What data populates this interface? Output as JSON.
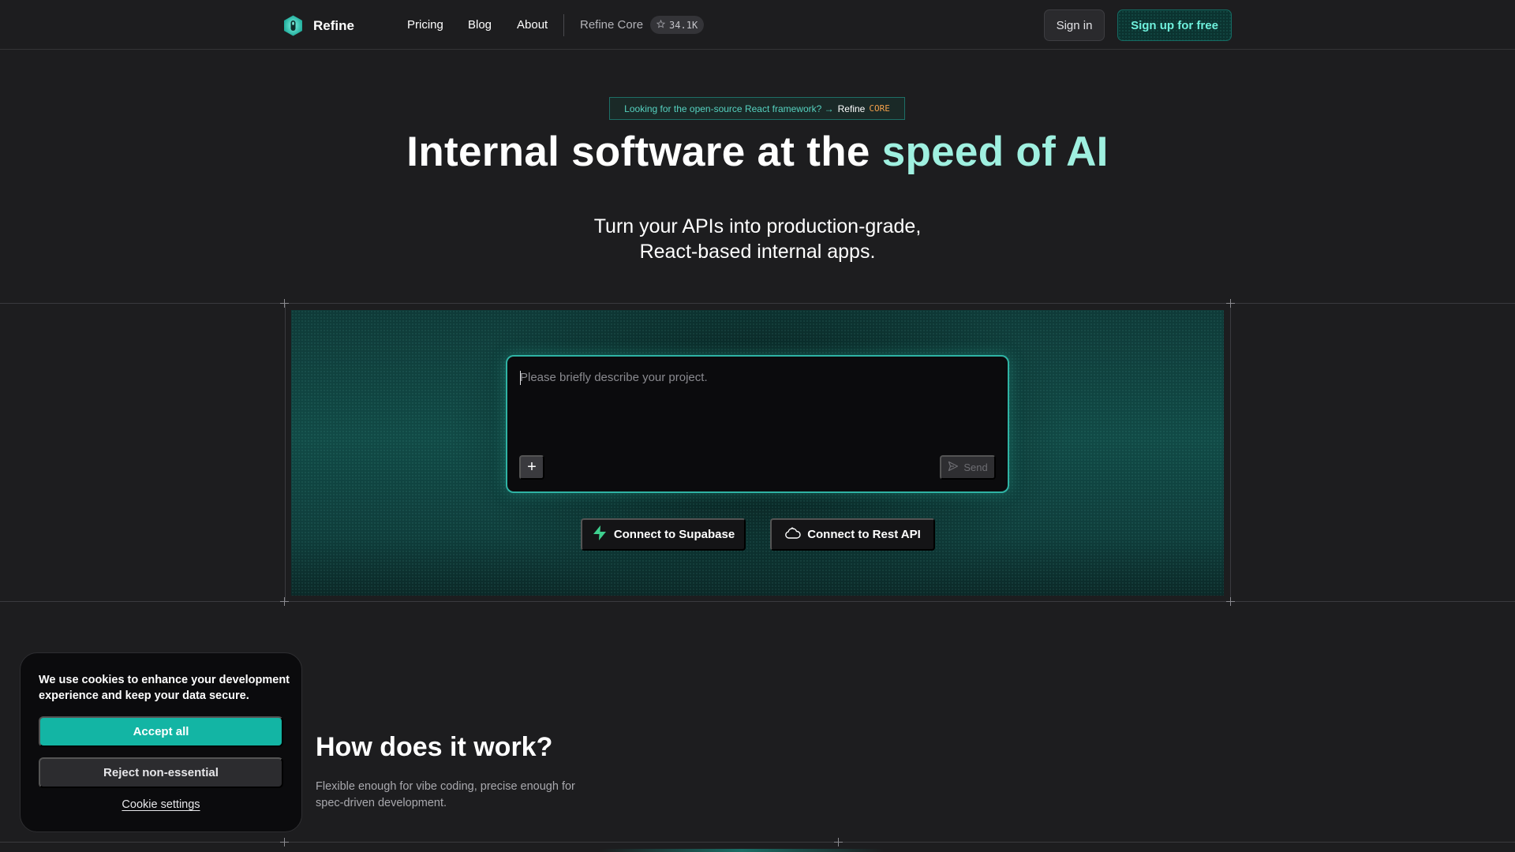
{
  "nav": {
    "logo_text": "Refine",
    "links": [
      {
        "label": "Pricing"
      },
      {
        "label": "Blog"
      },
      {
        "label": "About"
      }
    ],
    "core_label": "Refine Core",
    "core_stars": "34.1K",
    "signin_label": "Sign in",
    "signup_label": "Sign up for free"
  },
  "banner": {
    "text": "Looking for the open-source React framework? →",
    "refine": "Refine",
    "core": "CORE"
  },
  "hero": {
    "title_main": "Internal software at the ",
    "title_accent": "speed of AI",
    "subtitle_line1": "Turn your APIs into production-grade,",
    "subtitle_line2": "React-based internal apps."
  },
  "prompt": {
    "placeholder": "Please briefly describe your project.",
    "value": "",
    "add_label": "+",
    "send_label": "Send"
  },
  "connect": {
    "supabase_label": "Connect to Supabase",
    "rest_label": "Connect to Rest API"
  },
  "how": {
    "title": "How does it work?",
    "subtitle": "Flexible enough for vibe coding, precise enough for spec-driven development."
  },
  "cookie": {
    "message": "We use cookies to enhance your development experience and keep your data secure.",
    "accept_label": "Accept all",
    "reject_label": "Reject non-essential",
    "settings_label": "Cookie settings"
  },
  "colors": {
    "background": "#1d1d1f",
    "accent": "#13b5a4",
    "accent_text": "#9ff0e0",
    "core_orange": "#f3a04b"
  },
  "icons": {
    "logo": "refine-logo-icon",
    "star": "star-icon",
    "send": "send-icon",
    "supabase": "supabase-bolt-icon",
    "rest": "cloud-api-icon"
  }
}
